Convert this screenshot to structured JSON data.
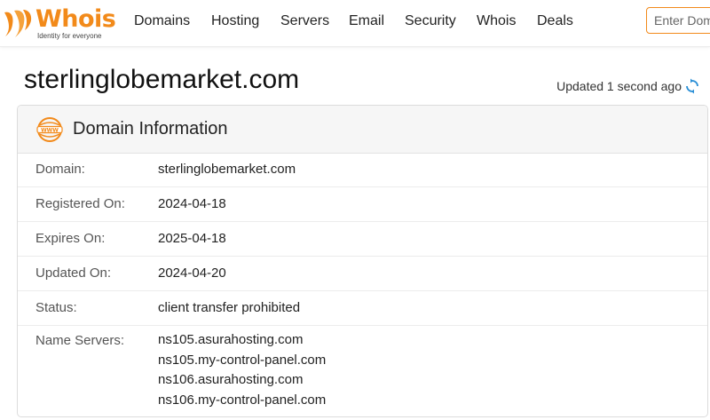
{
  "brand": {
    "name": "Whois",
    "tagline": "Identity for everyone",
    "accent": "#f28a1a"
  },
  "nav": {
    "items": [
      {
        "label": "Domains"
      },
      {
        "label": "Hosting"
      },
      {
        "label": "Servers"
      },
      {
        "label": "Email"
      },
      {
        "label": "Security"
      },
      {
        "label": "Whois"
      },
      {
        "label": "Deals"
      }
    ]
  },
  "search": {
    "placeholder": "Enter Domain"
  },
  "page": {
    "title": "sterlinglobemarket.com",
    "updated": "Updated 1 second ago"
  },
  "domain_info": {
    "title": "Domain Information",
    "icon": "www-icon",
    "rows": [
      {
        "label": "Domain:",
        "value": "sterlinglobemarket.com"
      },
      {
        "label": "Registered On:",
        "value": "2024-04-18"
      },
      {
        "label": "Expires On:",
        "value": "2025-04-18"
      },
      {
        "label": "Updated On:",
        "value": "2024-04-20"
      },
      {
        "label": "Status:",
        "value": "client transfer prohibited"
      }
    ],
    "name_servers": {
      "label": "Name Servers:",
      "values": [
        "ns105.asurahosting.com",
        "ns105.my-control-panel.com",
        "ns106.asurahosting.com",
        "ns106.my-control-panel.com"
      ]
    }
  }
}
